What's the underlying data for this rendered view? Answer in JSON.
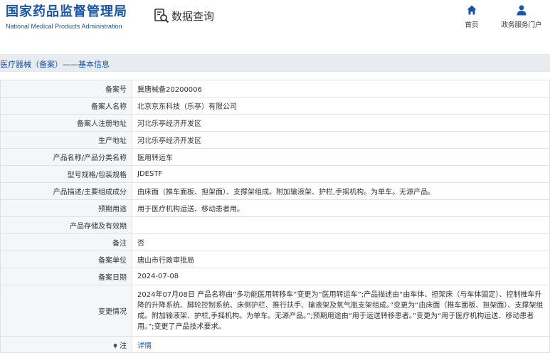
{
  "header": {
    "logo_cn": "国家药品监督管理局",
    "logo_en": "National Medical Products Administration",
    "query_label": "数据查询",
    "nav": [
      {
        "label": "首页",
        "icon": "home-icon"
      },
      {
        "label": "政务服务门户",
        "icon": "user-icon"
      }
    ]
  },
  "section_title": "医疗器械（备案）——基本信息",
  "rows": [
    {
      "label": "备案号",
      "value": "冀唐械备20200006"
    },
    {
      "label": "备案人名称",
      "value": "北京京东科技（乐亭）有限公司"
    },
    {
      "label": "备案人注册地址",
      "value": "河北乐亭经济开发区"
    },
    {
      "label": "生产地址",
      "value": "河北乐亭经济开发区"
    },
    {
      "label": "产品名称/产品分类名称",
      "value": "医用转运车"
    },
    {
      "label": "型号规格/包装规格",
      "value": "JDESTF"
    },
    {
      "label": "产品描述/主要组成成分",
      "value": "由床面（推车面板、担架面）、支撑架组成。附加输液架、护栏,手摇机构。为单车。无源产品。"
    },
    {
      "label": "预期用途",
      "value": "用于医疗机构运送、移动患者用。"
    },
    {
      "label": "产品存储及有效期",
      "value": ""
    },
    {
      "label": "备注",
      "value": "否"
    },
    {
      "label": "备案单位",
      "value": "唐山市行政审批局"
    },
    {
      "label": "备案日期",
      "value": "2024-07-08"
    },
    {
      "label": "变更情况",
      "value": "2024年07月08日 产品名称由“多功能医用转移车”变更为“医用转运车”;产品描述由“由车体、担架床（与车体固定）、控制推车升降的升降系统、脚轮控制系统、床侧护栏、推行扶手、输液架及氧气瓶支架组成。”变更为“由床面（推车面板、担架面）、支撑架组成。附加输液架、护栏,手摇机构。为单车。无源产品。”;预期用途由“用于运送转移患者。”变更为“用于医疗机构运送、移动患者用。”;变更了产品技术要求。"
    }
  ],
  "note": {
    "label": "注",
    "link": "详情"
  },
  "colors": {
    "brand": "#1a55a3",
    "label_bg": "#f5f6f8",
    "border": "#dfe3e8",
    "title_bg": "#e8ecf1"
  }
}
